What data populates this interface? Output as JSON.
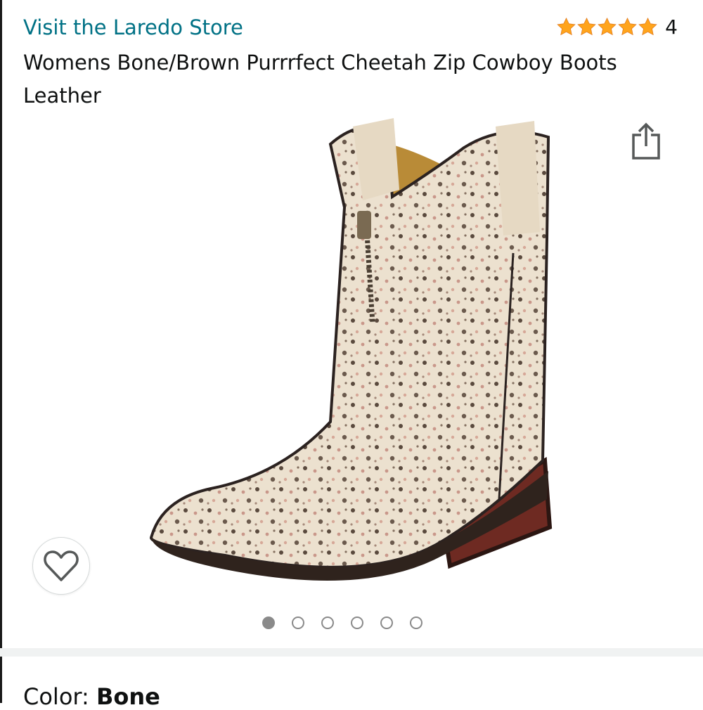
{
  "store_link": "Visit the Laredo Store",
  "rating": {
    "stars": 5,
    "count": "4"
  },
  "product_title": "Womens Bone/Brown Purrrfect Cheetah Zip Cowboy Boots Leather",
  "icons": {
    "share": "share-icon",
    "wishlist": "heart-icon",
    "star": "star-icon"
  },
  "carousel": {
    "total": 6,
    "active_index": 0
  },
  "color": {
    "label": "Color:",
    "value": "Bone"
  },
  "colors": {
    "link": "#007185",
    "star": "#ffa41c",
    "text": "#0f1111"
  }
}
